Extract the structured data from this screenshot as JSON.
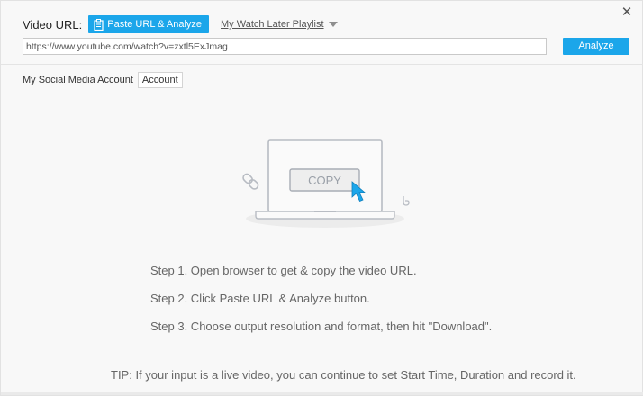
{
  "header": {
    "video_url_label": "Video URL:",
    "paste_button_label": "Paste URL & Analyze",
    "watch_later_label": "My Watch Later Playlist",
    "url_value": "https://www.youtube.com/watch?v=zxtl5ExJmag",
    "analyze_label": "Analyze",
    "close_icon": "close-icon"
  },
  "social": {
    "label": "My Social Media Account",
    "account_button": "Account"
  },
  "illustration": {
    "copy_text": "COPY"
  },
  "steps": [
    "Step 1. Open browser to get & copy the video URL.",
    "Step 2. Click Paste URL & Analyze button.",
    "Step 3. Choose output resolution and format, then hit \"Download\"."
  ],
  "tip": "TIP: If your input is a live video, you can continue to set Start Time, Duration and record it.",
  "colors": {
    "accent": "#1ba6ea",
    "background": "#f8f8f8",
    "text_muted": "#666666"
  }
}
